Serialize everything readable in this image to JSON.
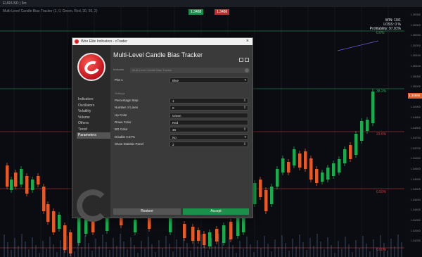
{
  "topbar": {
    "text": "EUR/USD | 5m"
  },
  "chart_header": {
    "subtitle": "Multi-Level Candle Bias Tracker (1, 0, Green, Red, 30, 50, 2)"
  },
  "prices": {
    "buy": "1.3488",
    "sell": "1.3486"
  },
  "stats": {
    "line1": "WIN: 10/1",
    "line2": "LOSS: 0 %",
    "line3": "Profitability: 97.01%"
  },
  "levels": [
    {
      "label": "0.0%",
      "color": "#2fae5a"
    },
    {
      "label": "38.2%",
      "color": "#2fae5a"
    },
    {
      "label": "23.6%",
      "color": "#d33b3b"
    },
    {
      "label": "0.00%",
      "color": "#d33b3b"
    },
    {
      "label": "0.00%",
      "color": "#d33b3b"
    }
  ],
  "current_price": "1.34886",
  "axis_ticks": [
    "1.35350",
    "1.35300",
    "1.35250",
    "1.35200",
    "1.35150",
    "1.35100",
    "1.35050",
    "1.35000",
    "1.34950",
    "1.34900",
    "1.34850",
    "1.34800",
    "1.34750",
    "1.34700",
    "1.34650",
    "1.34600",
    "1.34550",
    "1.34500",
    "1.34450",
    "1.34400",
    "1.34350",
    "1.34300",
    "1.34250"
  ],
  "dialog": {
    "title": "Woo Elite Indicators - cTrader",
    "heading": "Multi-Level Candle Bias Tracker",
    "indicator_label": "Indicator",
    "indicator_value": "Multi-Level Candle Bias Tracker",
    "nav": [
      "Indicators",
      "Oscillators",
      "Volatility",
      "Volume",
      "Others",
      "Trend",
      "Parameters"
    ],
    "active_nav": "Parameters",
    "plot_label": "Plot 1",
    "plot_value": "Blue",
    "section": "Settings",
    "fields": [
      {
        "label": "Percentage Step",
        "value": "1",
        "type": "spin"
      },
      {
        "label": "Number of Lines",
        "value": "0",
        "type": "spin"
      },
      {
        "label": "Up Color",
        "value": "Green",
        "type": "text"
      },
      {
        "label": "Down Color",
        "value": "Red",
        "type": "text"
      },
      {
        "label": "BG Color",
        "value": "30",
        "type": "spin"
      },
      {
        "label": "Disable 0.67%",
        "value": "No",
        "type": "select"
      },
      {
        "label": "Show Statistic Panel",
        "value": "2",
        "type": "spin"
      }
    ],
    "restore_label": "Restore",
    "accept_label": "Accept"
  }
}
